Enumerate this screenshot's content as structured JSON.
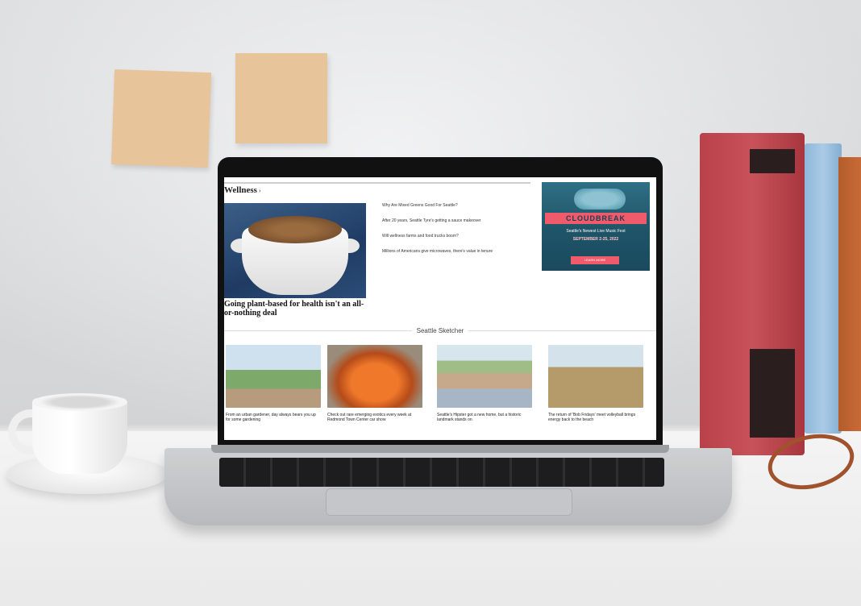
{
  "screen": {
    "section_title": "Wellness",
    "section_chevron": "›",
    "hero": {
      "headline": "Going plant-based for health isn't an all-or-nothing deal"
    },
    "links": [
      "Why Are Mixed Greens Good For Seattle?",
      "After 20 years, Seattle Tyre's getting a sauce makeover",
      "Will wellness farms and food trucks boom?",
      "Millions of Americans give microwaves, there's value in tenure"
    ],
    "ad": {
      "brand": "CLOUDBREAK",
      "tagline": "Seattle's Newest Live Music Fest",
      "date": "SEPTEMBER 2-25, 2022",
      "cta": "LEARN MORE"
    },
    "sketcher": {
      "title": "Seattle Sketcher",
      "cards": [
        "From an urban gardener, day always bears you up for some gardening",
        "Check out rare emerging exotics every week at Redmond Town Center car show",
        "Seattle's Hipster got a new home, but a historic landmark stands on",
        "The return of 'Bob Fridays' meet volleyball brings energy back to the beach"
      ]
    }
  },
  "colors": {
    "ad_background": "#1e5468",
    "ad_accent": "#f05a6a",
    "sticky_note": "#e8c49a",
    "book_red": "#c8525a",
    "book_blue": "#a9cbe6"
  }
}
